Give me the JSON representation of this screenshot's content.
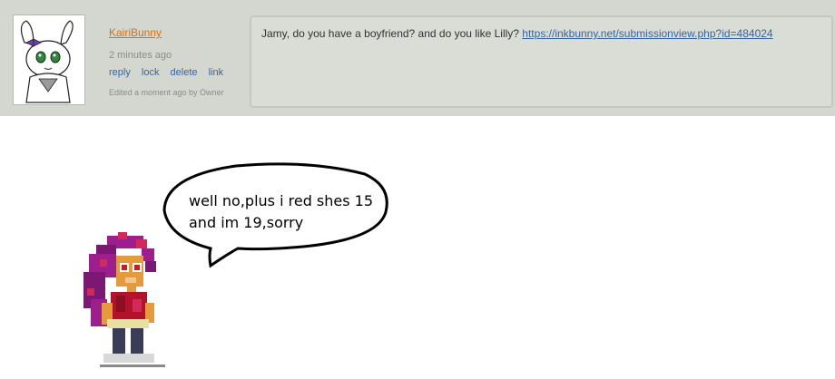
{
  "comment": {
    "username": "KairiBunny",
    "time": "2 minutes ago",
    "actions": [
      "reply",
      "lock",
      "delete",
      "link"
    ],
    "edited": "Edited a moment ago by Owner",
    "text": "Jamy, do you have a boyfriend? and do you like Lilly? ",
    "link": "https://inkbunny.net/submissionview.php?id=484024"
  },
  "speech_bubble": {
    "line1": "well no,plus i red shes 15",
    "line2": "and im 19,sorry"
  },
  "colors": {
    "band": "#d3d7cf",
    "username": "#d8710d",
    "link": "#3465a4",
    "character_hair": "#9d1f8e"
  }
}
